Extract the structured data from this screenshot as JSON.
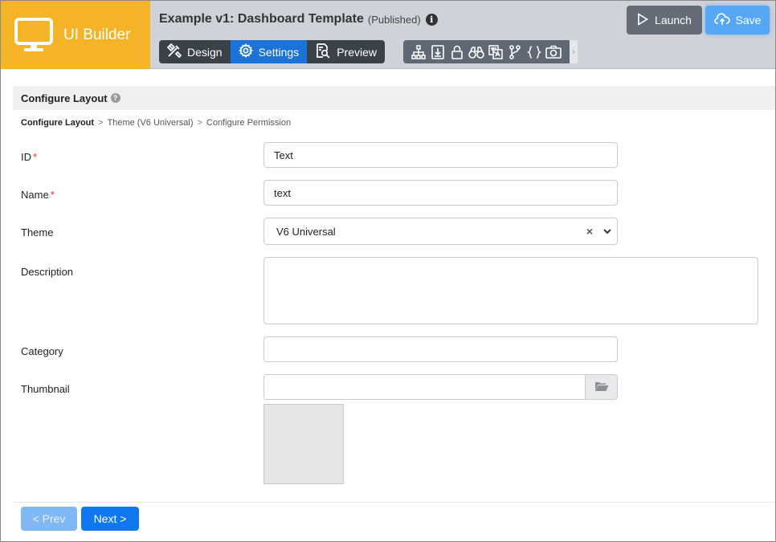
{
  "app": {
    "brand_name": "UI Builder",
    "brand_color": "#f5b427"
  },
  "header": {
    "title": "Example v1: Dashboard Template",
    "status": "(Published)",
    "info_icon": "i",
    "tabs": [
      {
        "label": "Design",
        "icon": "design-tools-icon",
        "active": false
      },
      {
        "label": "Settings",
        "icon": "gear-icon",
        "active": true
      },
      {
        "label": "Preview",
        "icon": "preview-icon",
        "active": false
      }
    ],
    "tools": [
      "sitemap-icon",
      "export-icon",
      "lock-icon",
      "binoculars-icon",
      "translate-icon",
      "branch-icon",
      "braces-icon",
      "camera-icon"
    ],
    "launch_label": "Launch",
    "save_label": "Save",
    "accent_color": "#1a73d9"
  },
  "section": {
    "title": "Configure Layout",
    "help_icon": "?"
  },
  "breadcrumb": {
    "items": [
      "Configure Layout",
      "Theme (V6 Universal)",
      "Configure Permission"
    ],
    "separator": ">"
  },
  "form": {
    "required_mark": "*",
    "id": {
      "label": "ID",
      "value": "Text"
    },
    "name": {
      "label": "Name",
      "value": "text"
    },
    "theme": {
      "label": "Theme",
      "value": "V6 Universal",
      "clear": "×"
    },
    "description": {
      "label": "Description",
      "value": ""
    },
    "category": {
      "label": "Category",
      "value": ""
    },
    "thumbnail": {
      "label": "Thumbnail",
      "value": ""
    }
  },
  "footer": {
    "prev_label": "< Prev",
    "next_label": "Next >"
  }
}
